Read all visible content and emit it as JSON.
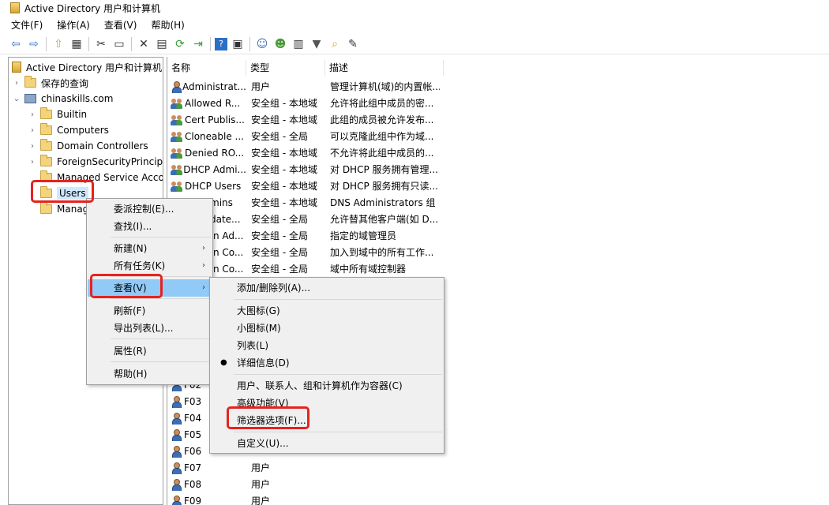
{
  "window": {
    "title": "Active Directory 用户和计算机"
  },
  "menu": [
    "文件(F)",
    "操作(A)",
    "查看(V)",
    "帮助(H)"
  ],
  "toolbar": {
    "icons": [
      "back-icon",
      "forward-icon",
      "up-icon",
      "show-tree-icon",
      "cut-icon",
      "copy-icon",
      "delete-icon",
      "properties-icon",
      "refresh-icon",
      "export-icon",
      "help-icon",
      "console-icon",
      "new-user-icon",
      "new-group-icon",
      "new-ou-icon",
      "filter-icon",
      "find-icon",
      "delegate-icon"
    ]
  },
  "tree": {
    "root": "Active Directory 用户和计算机",
    "saved_queries": "保存的查询",
    "domain": "chinaskills.com",
    "children": [
      "Builtin",
      "Computers",
      "Domain Controllers",
      "ForeignSecurityPrincipals",
      "Managed Service Accounts",
      "Users",
      "Managed"
    ],
    "children_display": [
      "Builtin",
      "Computers",
      "Domain Controllers",
      "ForeignSecurityPrincipa",
      "Managed Service Acco",
      "Users",
      "Manag"
    ]
  },
  "list": {
    "columns": [
      "名称",
      "类型",
      "描述"
    ],
    "rows": [
      {
        "name": "Administrat...",
        "type": "用户",
        "desc": "管理计算机(域)的内置帐...",
        "kind": "user"
      },
      {
        "name": "Allowed R...",
        "type": "安全组 - 本地域",
        "desc": "允许将此组中成员的密...",
        "kind": "group"
      },
      {
        "name": "Cert Publis...",
        "type": "安全组 - 本地域",
        "desc": "此组的成员被允许发布...",
        "kind": "group"
      },
      {
        "name": "Cloneable ...",
        "type": "安全组 - 全局",
        "desc": "可以克隆此组中作为域...",
        "kind": "group"
      },
      {
        "name": "Denied RO...",
        "type": "安全组 - 本地域",
        "desc": "不允许将此组中成员的...",
        "kind": "group"
      },
      {
        "name": "DHCP Admi...",
        "type": "安全组 - 本地域",
        "desc": "对 DHCP 服务拥有管理...",
        "kind": "group"
      },
      {
        "name": "DHCP Users",
        "type": "安全组 - 本地域",
        "desc": "对 DHCP 服务拥有只读...",
        "kind": "group"
      },
      {
        "name": "mins",
        "type": "安全组 - 本地域",
        "desc": "DNS Administrators 组",
        "kind": "none"
      },
      {
        "name": "date...",
        "type": "安全组 - 全局",
        "desc": "允许替其他客户端(如 D...",
        "kind": "none"
      },
      {
        "name": "n Ad...",
        "type": "安全组 - 全局",
        "desc": "指定的域管理员",
        "kind": "none"
      },
      {
        "name": "n Co...",
        "type": "安全组 - 全局",
        "desc": "加入到域中的所有工作...",
        "kind": "none"
      },
      {
        "name": "n Co...",
        "type": "安全组 - 全局",
        "desc": "域中所有域控制器",
        "kind": "none"
      },
      {
        "name": "F02",
        "type": "",
        "desc": "",
        "kind": "user"
      },
      {
        "name": "F03",
        "type": "",
        "desc": "",
        "kind": "user"
      },
      {
        "name": "F04",
        "type": "",
        "desc": "",
        "kind": "user"
      },
      {
        "name": "F05",
        "type": "",
        "desc": "",
        "kind": "user"
      },
      {
        "name": "F06",
        "type": "",
        "desc": "",
        "kind": "user"
      },
      {
        "name": "F07",
        "type": "用户",
        "desc": "",
        "kind": "user"
      },
      {
        "name": "F08",
        "type": "用户",
        "desc": "",
        "kind": "user"
      },
      {
        "name": "F09",
        "type": "用户",
        "desc": "",
        "kind": "user"
      }
    ]
  },
  "context_menu": {
    "items": [
      "委派控制(E)...",
      "查找(I)...",
      "新建(N)",
      "所有任务(K)",
      "查看(V)",
      "刷新(F)",
      "导出列表(L)...",
      "属性(R)",
      "帮助(H)"
    ],
    "submenu_arrow": "›"
  },
  "view_submenu": {
    "items": [
      "添加/删除列(A)...",
      "大图标(G)",
      "小图标(M)",
      "列表(L)",
      "详细信息(D)",
      "用户、联系人、组和计算机作为容器(C)",
      "高级功能(V)",
      "筛选器选项(F)...",
      "自定义(U)..."
    ],
    "bullet": "●"
  },
  "tree_arrows": {
    "collapsed": "›",
    "expanded": "⌄"
  },
  "toolbar_glyphs": [
    "⇦",
    "⇨",
    "⇧",
    "▦",
    "✂",
    "▭",
    "✕",
    "▤",
    "⟳",
    "⇥",
    "?",
    "▣",
    "☺",
    "☻",
    "▥",
    "▼",
    "⌕",
    "✎"
  ]
}
